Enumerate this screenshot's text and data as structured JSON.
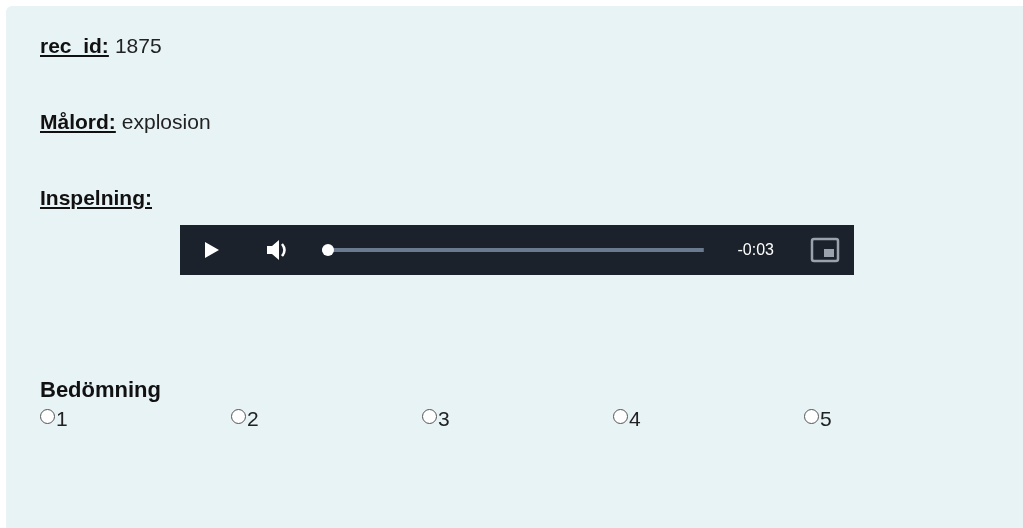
{
  "fields": [
    {
      "label": "rec_id:",
      "value": "1875"
    },
    {
      "label": "Målord:",
      "value": "explosion"
    }
  ],
  "recording": {
    "label": "Inspelning:",
    "player": {
      "time": "-0:03",
      "level": 0
    }
  },
  "rating": {
    "title": "Bedömning",
    "options": [
      {
        "label": "1",
        "selected": false
      },
      {
        "label": "2",
        "selected": false
      },
      {
        "label": "3",
        "selected": false
      },
      {
        "label": "4",
        "selected": false
      },
      {
        "label": "5",
        "selected": false
      }
    ]
  }
}
